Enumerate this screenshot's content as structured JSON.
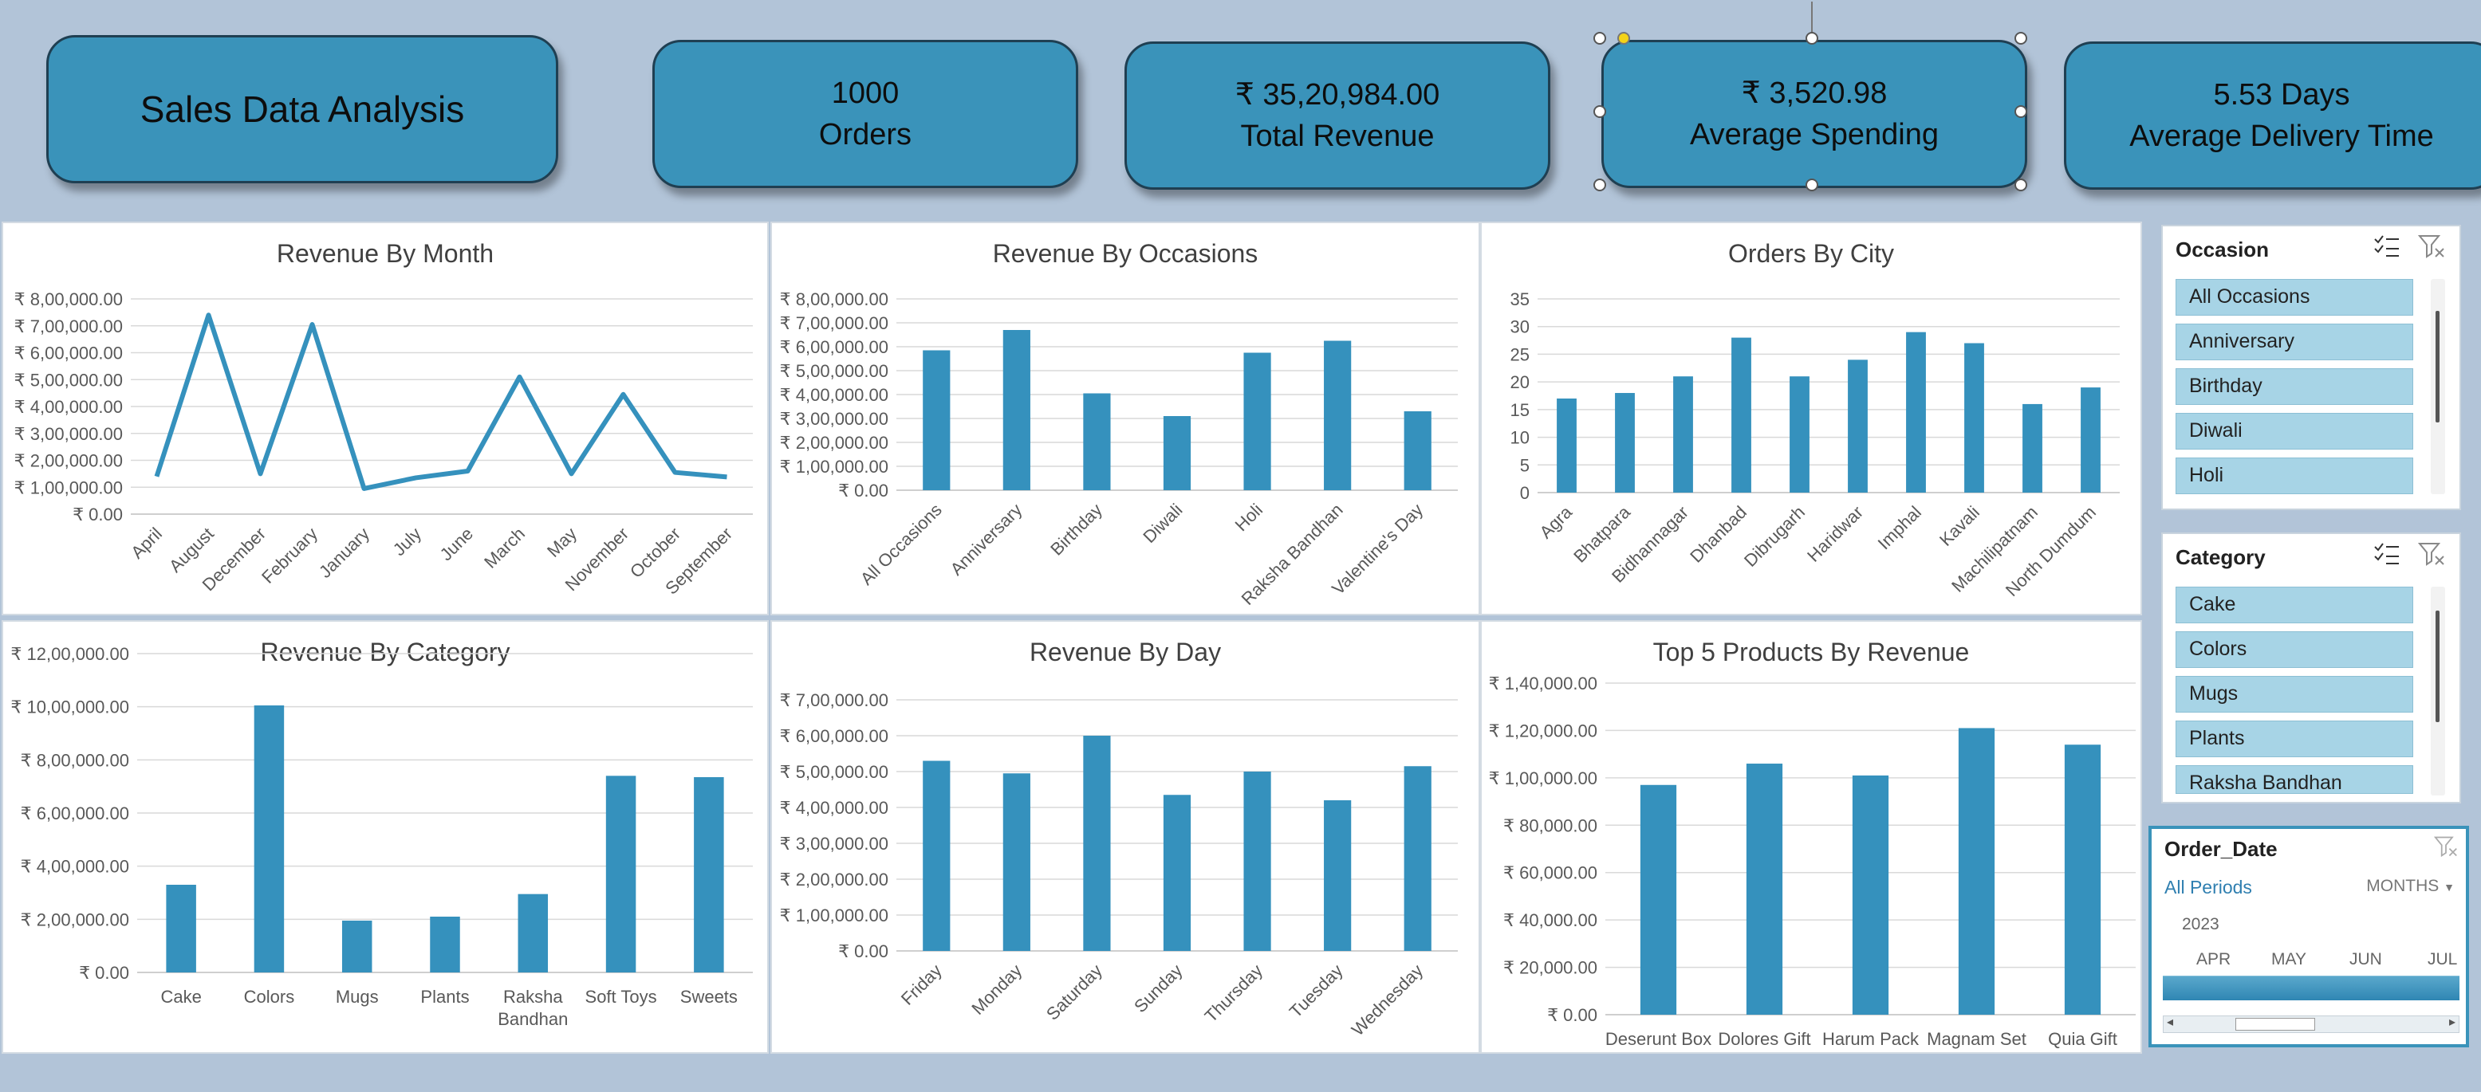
{
  "dashboard": {
    "title": "Sales Data Analysis",
    "kpis": [
      {
        "value": "1000",
        "label": "Orders"
      },
      {
        "value": "₹ 35,20,984.00",
        "label": "Total Revenue"
      },
      {
        "value": "₹ 3,520.98",
        "label": "Average Spending"
      },
      {
        "value": "5.53 Days",
        "label": "Average Delivery Time"
      }
    ]
  },
  "colors": {
    "bar": "#3591bd",
    "background": "#b2c4d8",
    "kpi": "#3a93ba",
    "slicer_item": "#a7d4e6"
  },
  "slicers": {
    "occasion": {
      "title": "Occasion",
      "items": [
        "All Occasions",
        "Anniversary",
        "Birthday",
        "Diwali",
        "Holi"
      ]
    },
    "category": {
      "title": "Category",
      "items": [
        "Cake",
        "Colors",
        "Mugs",
        "Plants",
        "Raksha Bandhan"
      ]
    }
  },
  "timeline": {
    "title": "Order_Date",
    "period_label": "All Periods",
    "level": "MONTHS",
    "year": "2023",
    "months": [
      "APR",
      "MAY",
      "JUN",
      "JUL"
    ]
  },
  "chart_data": [
    {
      "id": "month",
      "type": "line",
      "title": "Revenue By Month",
      "categories": [
        "April",
        "August",
        "December",
        "February",
        "January",
        "July",
        "June",
        "March",
        "May",
        "November",
        "October",
        "September"
      ],
      "values": [
        140000,
        740000,
        150000,
        705000,
        95000,
        135000,
        160000,
        510000,
        150000,
        445000,
        155000,
        138000
      ],
      "ylim": [
        0,
        800000
      ],
      "yticks": [
        "₹ 0.00",
        "₹ 1,00,000.00",
        "₹ 2,00,000.00",
        "₹ 3,00,000.00",
        "₹ 4,00,000.00",
        "₹ 5,00,000.00",
        "₹ 6,00,000.00",
        "₹ 7,00,000.00",
        "₹ 8,00,000.00"
      ],
      "grid": true
    },
    {
      "id": "occasion",
      "type": "bar",
      "title": "Revenue By Occasions",
      "categories": [
        "All Occasions",
        "Anniversary",
        "Birthday",
        "Diwali",
        "Holi",
        "Raksha Bandhan",
        "Valentine's Day"
      ],
      "values": [
        585000,
        670000,
        405000,
        310000,
        575000,
        625000,
        330000
      ],
      "ylim": [
        0,
        800000
      ],
      "yticks": [
        "₹ 0.00",
        "₹ 1,00,000.00",
        "₹ 2,00,000.00",
        "₹ 3,00,000.00",
        "₹ 4,00,000.00",
        "₹ 5,00,000.00",
        "₹ 6,00,000.00",
        "₹ 7,00,000.00",
        "₹ 8,00,000.00"
      ],
      "grid": true
    },
    {
      "id": "city",
      "type": "bar",
      "title": "Orders By City",
      "categories": [
        "Agra",
        "Bhatpara",
        "Bidhannagar",
        "Dhanbad",
        "Dibrugarh",
        "Haridwar",
        "Imphal",
        "Kavali",
        "Machilipatnam",
        "North Dumdum"
      ],
      "values": [
        17,
        18,
        21,
        28,
        21,
        24,
        29,
        27,
        16,
        19
      ],
      "ylim": [
        0,
        35
      ],
      "yticks": [
        "0",
        "5",
        "10",
        "15",
        "20",
        "25",
        "30",
        "35"
      ],
      "grid": true
    },
    {
      "id": "category",
      "type": "bar",
      "title": "Revenue By Category",
      "categories": [
        "Cake",
        "Colors",
        "Mugs",
        "Plants",
        "Raksha Bandhan",
        "Soft Toys",
        "Sweets"
      ],
      "values": [
        330000,
        1005000,
        195000,
        210000,
        295000,
        740000,
        735000
      ],
      "ylim": [
        0,
        1200000
      ],
      "yticks": [
        "₹ 0.00",
        "₹ 2,00,000.00",
        "₹ 4,00,000.00",
        "₹ 6,00,000.00",
        "₹ 8,00,000.00",
        "₹ 10,00,000.00",
        "₹ 12,00,000.00"
      ],
      "grid": true
    },
    {
      "id": "day",
      "type": "bar",
      "title": "Revenue By Day",
      "categories": [
        "Friday",
        "Monday",
        "Saturday",
        "Sunday",
        "Thursday",
        "Tuesday",
        "Wednesday"
      ],
      "values": [
        530000,
        495000,
        600000,
        435000,
        500000,
        420000,
        515000
      ],
      "ylim": [
        0,
        700000
      ],
      "yticks": [
        "₹ 0.00",
        "₹ 1,00,000.00",
        "₹ 2,00,000.00",
        "₹ 3,00,000.00",
        "₹ 4,00,000.00",
        "₹ 5,00,000.00",
        "₹ 6,00,000.00",
        "₹ 7,00,000.00"
      ],
      "grid": true
    },
    {
      "id": "products",
      "type": "bar",
      "title": "Top 5 Products By Revenue",
      "categories": [
        "Deserunt Box",
        "Dolores Gift",
        "Harum Pack",
        "Magnam Set",
        "Quia Gift"
      ],
      "values": [
        97000,
        106000,
        101000,
        121000,
        114000
      ],
      "ylim": [
        0,
        140000
      ],
      "yticks": [
        "₹ 0.00",
        "₹ 20,000.00",
        "₹ 40,000.00",
        "₹ 60,000.00",
        "₹ 80,000.00",
        "₹ 1,00,000.00",
        "₹ 1,20,000.00",
        "₹ 1,40,000.00"
      ],
      "grid": true
    }
  ]
}
